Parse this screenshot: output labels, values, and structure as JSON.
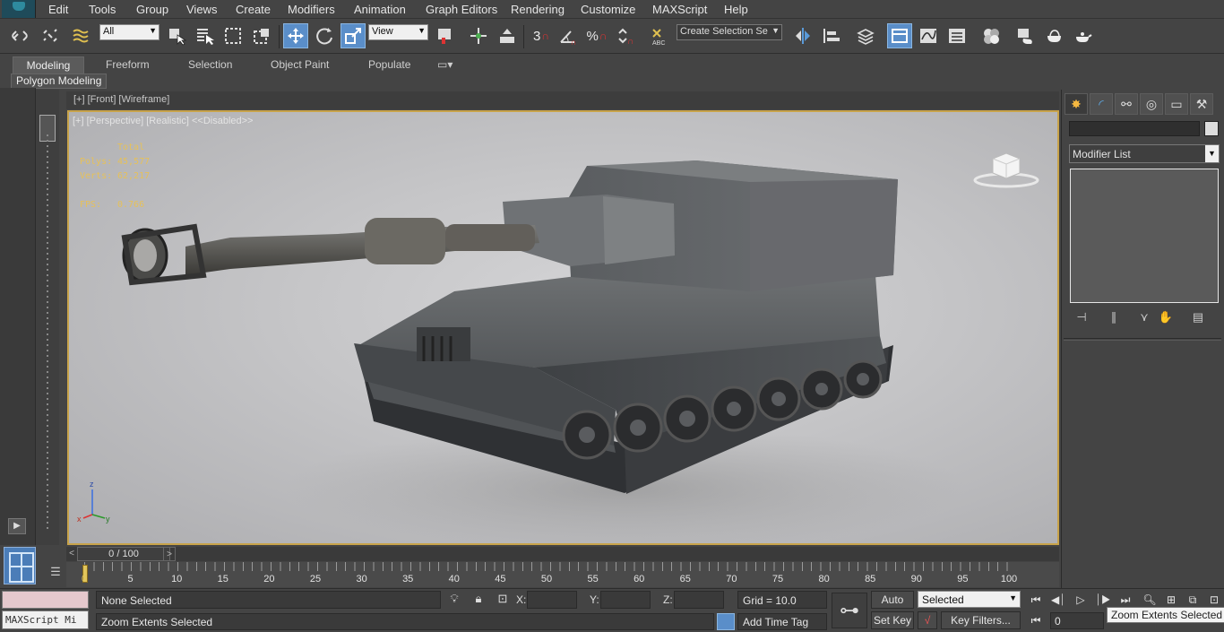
{
  "menu": [
    "Edit",
    "Tools",
    "Group",
    "Views",
    "Create",
    "Modifiers",
    "Animation",
    "Graph Editors",
    "Rendering",
    "Customize",
    "MAXScript",
    "Help"
  ],
  "toolbar": {
    "filter_value": "All",
    "refcoord_value": "View",
    "selection_set_placeholder": "Create Selection Se",
    "snap_label": "3",
    "percent_label": "%"
  },
  "ribbon": {
    "tabs": [
      "Modeling",
      "Freeform",
      "Selection",
      "Object Paint",
      "Populate"
    ],
    "panel_label": "Polygon Modeling"
  },
  "viewports": {
    "front_label": "[+] [Front] [Wireframe]",
    "perspective_label": "[+] [Perspective] [Realistic]  <<Disabled>>"
  },
  "stats": {
    "header": "Total",
    "polys_label": "Polys:",
    "polys_value": "45,577",
    "verts_label": "Verts:",
    "verts_value": "62,217",
    "fps_label": "FPS:",
    "fps_value": "0.766"
  },
  "axes": {
    "x": "x",
    "y": "y",
    "z": "z"
  },
  "command_panel": {
    "name_value": "",
    "modifier_list": "Modifier List"
  },
  "time_slider": {
    "label": "0 / 100",
    "prev": "<",
    "next": ">"
  },
  "track_numbers": [
    "0",
    "5",
    "10",
    "15",
    "20",
    "25",
    "30",
    "35",
    "40",
    "45",
    "50",
    "55",
    "60",
    "65",
    "70",
    "75",
    "80",
    "85",
    "90",
    "95",
    "100"
  ],
  "status": {
    "selection": "None Selected",
    "prompt": "Zoom Extents Selected",
    "maxscript": "MAXScript Mi",
    "x_label": "X:",
    "y_label": "Y:",
    "z_label": "Z:",
    "grid": "Grid = 10.0",
    "add_time_tag": "Add Time Tag",
    "auto_key": "Auto Key",
    "set_key": "Set Key",
    "selected_value": "Selected",
    "key_filters": "Key Filters...",
    "frame_value": "0",
    "tooltip": "Zoom Extents Selected"
  },
  "colors": {
    "viewport_border": "#c8a34a",
    "stats_text": "#e6c15a",
    "active_button": "#5a8ec9"
  }
}
